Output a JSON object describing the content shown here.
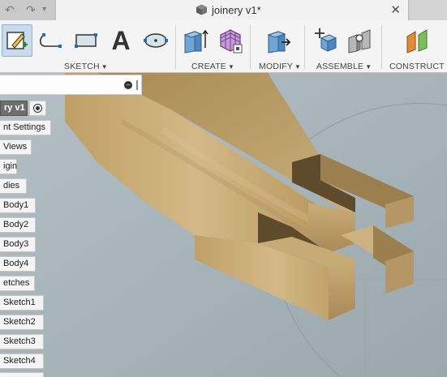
{
  "document": {
    "title": "joinery v1*"
  },
  "quick_access": {
    "undo_icon": "↶",
    "redo_icon": "↷",
    "dropdown_icon": "▾"
  },
  "tab": {
    "close_glyph": "✕"
  },
  "ribbon": {
    "groups": [
      {
        "label": "SKETCH",
        "caret": "▼"
      },
      {
        "label": "CREATE",
        "caret": "▼"
      },
      {
        "label": "MODIFY",
        "caret": "▼"
      },
      {
        "label": "ASSEMBLE",
        "caret": "▼"
      },
      {
        "label": "CONSTRUCT",
        "caret": "▼"
      }
    ],
    "text_tool_glyph": "A"
  },
  "browser": {
    "search_placeholder": "",
    "root": {
      "label": "ry v1"
    },
    "items": [
      {
        "label": "nt Settings"
      },
      {
        "label": "Views"
      },
      {
        "label": "igin"
      },
      {
        "label": "dies"
      },
      {
        "label": "Body1"
      },
      {
        "label": "Body2"
      },
      {
        "label": "Body3"
      },
      {
        "label": "Body4"
      },
      {
        "label": "etches"
      },
      {
        "label": "Sketch1"
      },
      {
        "label": "Sketch2"
      },
      {
        "label": "Sketch3"
      },
      {
        "label": "Sketch4"
      },
      {
        "label": ""
      }
    ]
  },
  "colors": {
    "viewport_bg": "#a9b7bd",
    "wood_light": "#c6ac78",
    "wood_mid": "#b0935e",
    "wood_dark": "#6e5a37",
    "accent": "#1c6fb8"
  }
}
